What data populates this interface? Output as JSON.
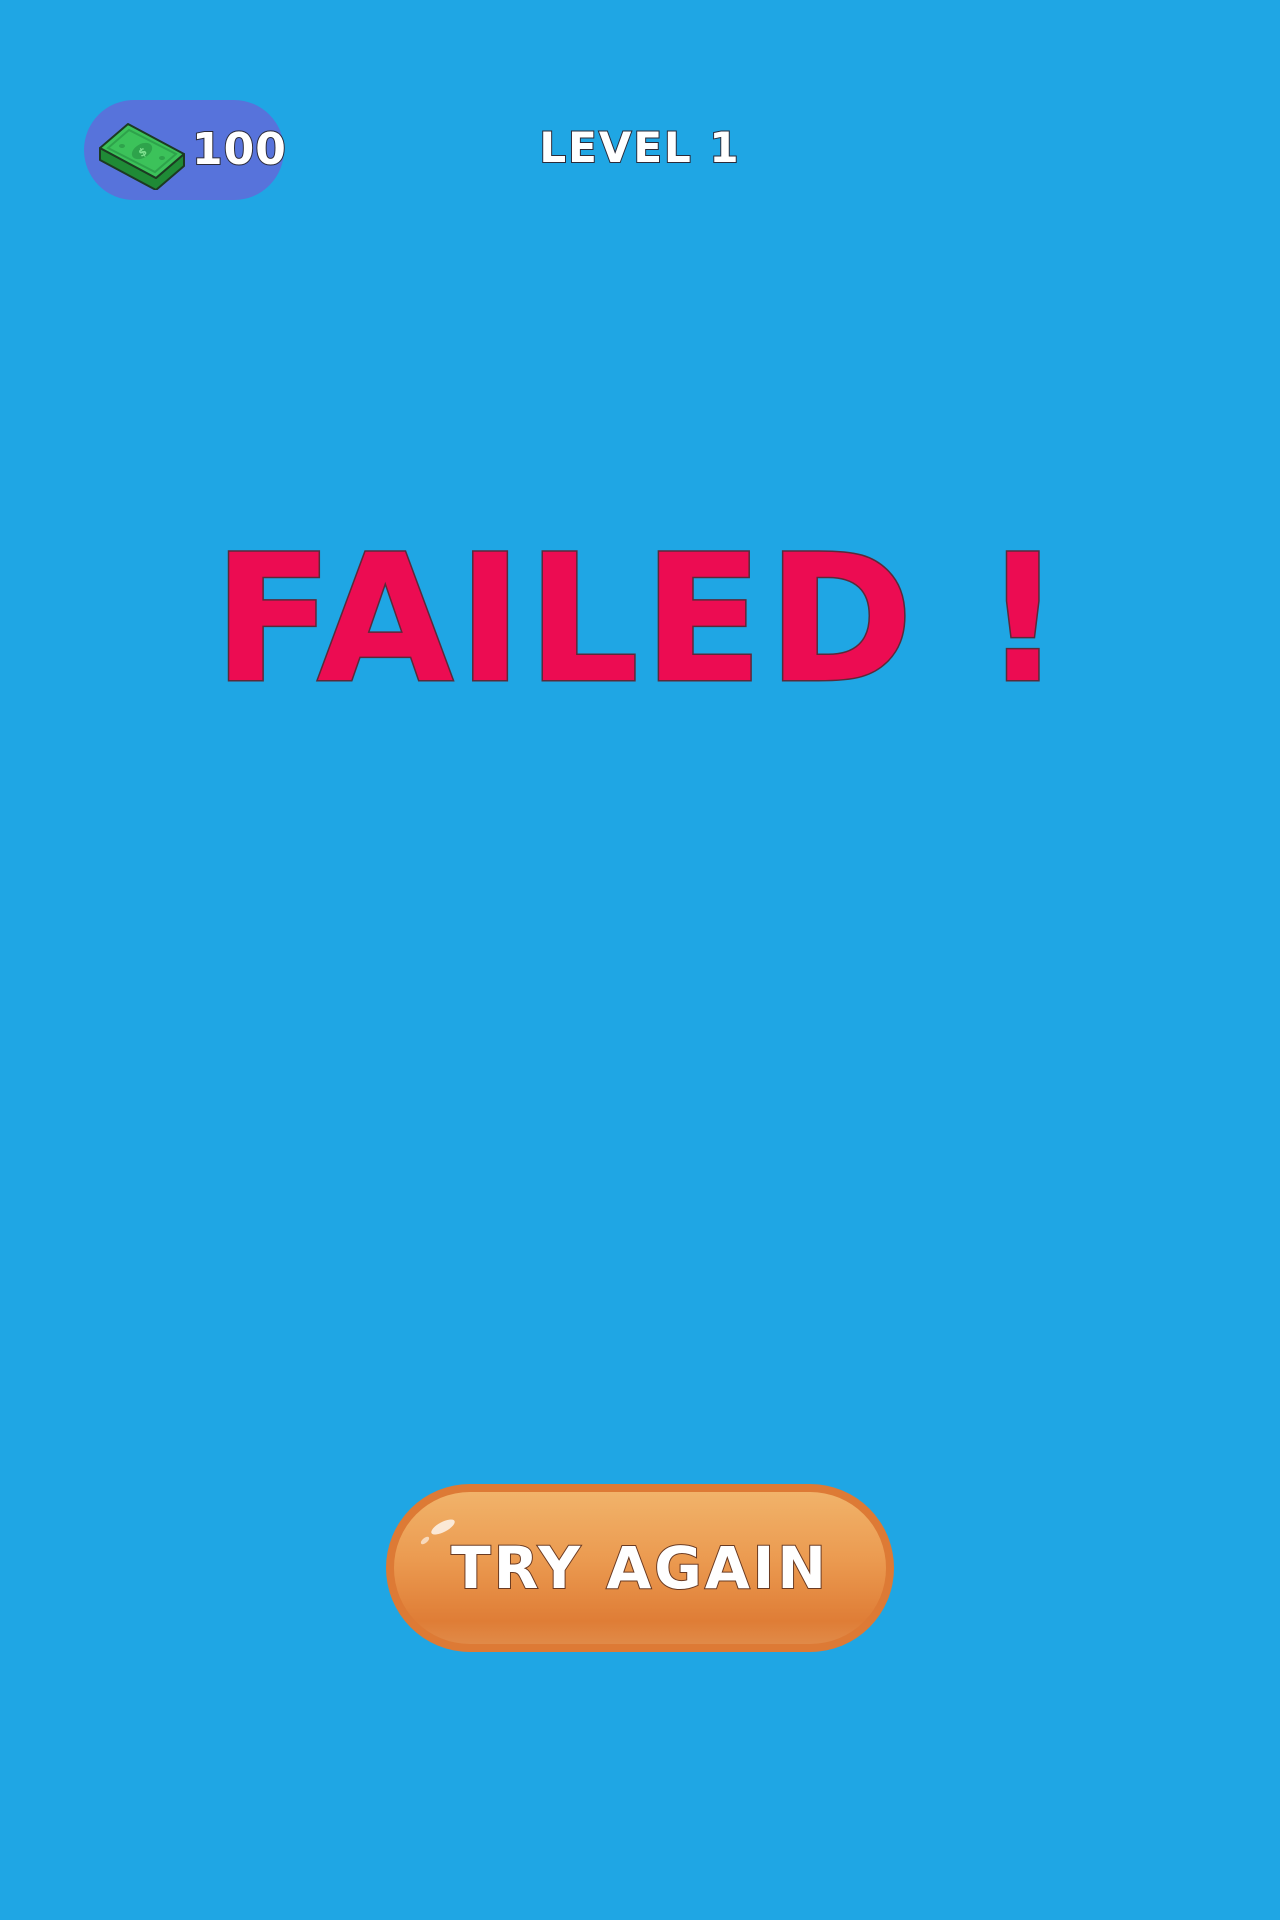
{
  "hud": {
    "currency": {
      "icon": "cash-stack-icon",
      "amount": "100"
    },
    "level_label": "LEVEL 1"
  },
  "result": {
    "title": "FAILED !"
  },
  "actions": {
    "try_again_label": "TRY AGAIN"
  },
  "colors": {
    "background": "#1fa6e4",
    "currency_pill": "#5773db",
    "failed_text": "#ec0c52",
    "button_orange": "#eb9a50",
    "cash_green": "#3cc25a"
  }
}
